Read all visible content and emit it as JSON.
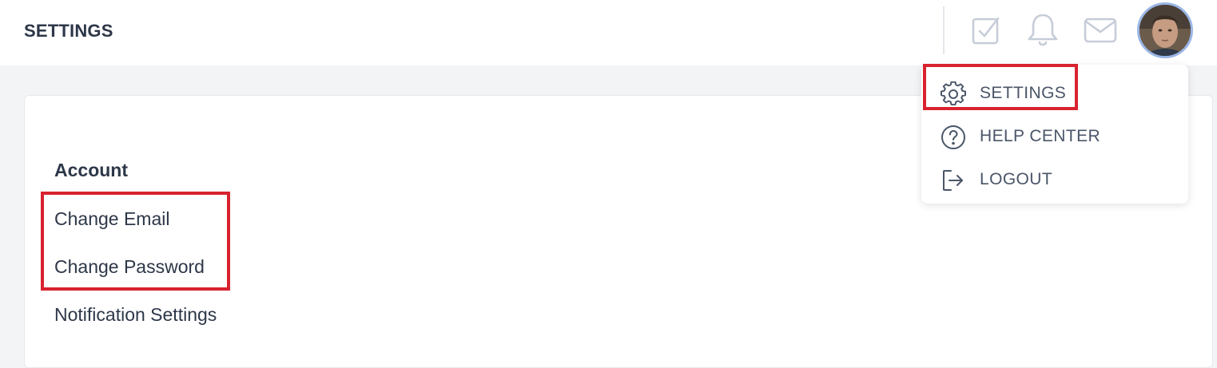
{
  "header": {
    "title": "SETTINGS"
  },
  "header_icons": [
    "checkbox-icon",
    "bell-icon",
    "mail-icon"
  ],
  "account": {
    "section_title": "Account",
    "links": [
      {
        "label": "Change Email"
      },
      {
        "label": "Change Password"
      },
      {
        "label": "Notification Settings"
      }
    ]
  },
  "dropdown": {
    "items": [
      {
        "label": "SETTINGS",
        "icon": "gear-icon"
      },
      {
        "label": "HELP CENTER",
        "icon": "question-circle-icon"
      },
      {
        "label": "LOGOUT",
        "icon": "logout-icon"
      }
    ]
  },
  "colors": {
    "highlight": "#d8232f",
    "text": "#2d3748",
    "icon": "#c6ccd8",
    "background": "#f3f4f6"
  }
}
